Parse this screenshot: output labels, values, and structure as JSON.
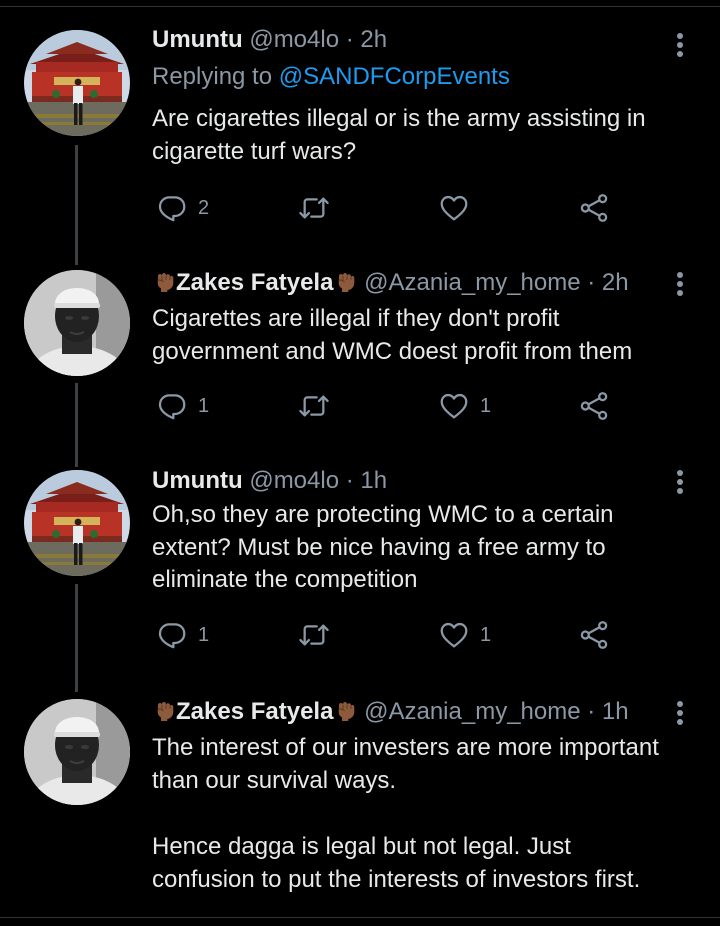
{
  "tweets": [
    {
      "name": "Umuntu",
      "handle": "@mo4lo",
      "time": "· 2h",
      "replying_prefix": "Replying to",
      "replying_to": "@SANDFCorpEvents",
      "text": [
        "Are cigarettes illegal or is the army assisting in",
        "cigarette turf wars?"
      ],
      "reply_count": "2",
      "retweet_count": "",
      "like_count": ""
    },
    {
      "name": "Zakes Fatyela",
      "handle": "@Azania_my_home",
      "time": "· 2h",
      "text": [
        "Cigarettes are illegal if they don't profit",
        "government and WMC doest profit from them"
      ],
      "reply_count": "1",
      "retweet_count": "",
      "like_count": "1"
    },
    {
      "name": "Umuntu",
      "handle": "@mo4lo",
      "time": "· 1h",
      "text": [
        "Oh,so they are protecting WMC to a certain",
        "extent? Must be nice having a free army to",
        "eliminate the competition"
      ],
      "reply_count": "1",
      "retweet_count": "",
      "like_count": "1"
    },
    {
      "name": "Zakes Fatyela",
      "handle": "@Azania_my_home",
      "time": "· 1h",
      "text": [
        "The interest of our investers are more important",
        "than our survival ways.",
        "",
        "Hence dagga is legal but not legal. Just",
        "confusion to put the interests of investors first."
      ]
    }
  ],
  "icons": {
    "reply": "reply-icon",
    "retweet": "retweet-icon",
    "like": "heart-icon",
    "share": "share-icon",
    "menu": "more-options-icon",
    "fist": "raised-fist-emoji"
  },
  "colors": {
    "background": "#000000",
    "text": "#e7e9ea",
    "muted": "#8b98a5",
    "link": "#1d9bf0"
  }
}
